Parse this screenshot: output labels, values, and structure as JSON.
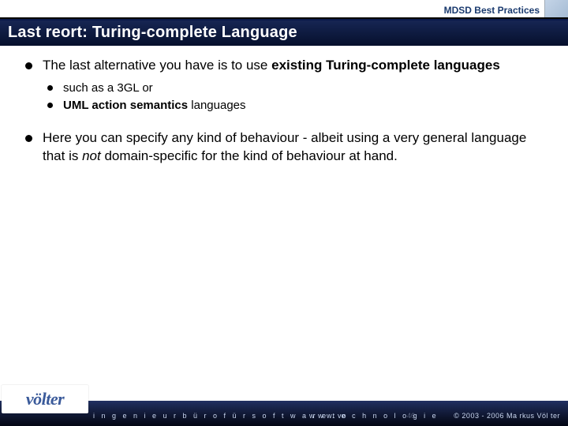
{
  "header": {
    "label": "MDSD Best Practices"
  },
  "title": "Last reort: Turing-complete Language",
  "bullets": [
    {
      "prefix": "The last alternative you have is to use ",
      "bold": "existing Turing-complete languages",
      "suffix": "",
      "sub": [
        {
          "plain": "such as a 3GL or"
        },
        {
          "bold": "UML action semantics",
          "plain_after": " languages"
        }
      ]
    },
    {
      "prefix": "Here you can specify any kind of behaviour - albeit using a very general language that is ",
      "italic": "not",
      "suffix": " domain-specific for the kind of behaviour at hand."
    }
  ],
  "footer": {
    "logo": "völter",
    "tagline": "i n g e n i e u r b ü r o   f ü r   s o f t w a r e t e c h n o l o g i e",
    "url": "w w w. vo",
    "pageno": "46",
    "copyright": "© 2003 - 2006 Ma rkus Völ ter"
  }
}
